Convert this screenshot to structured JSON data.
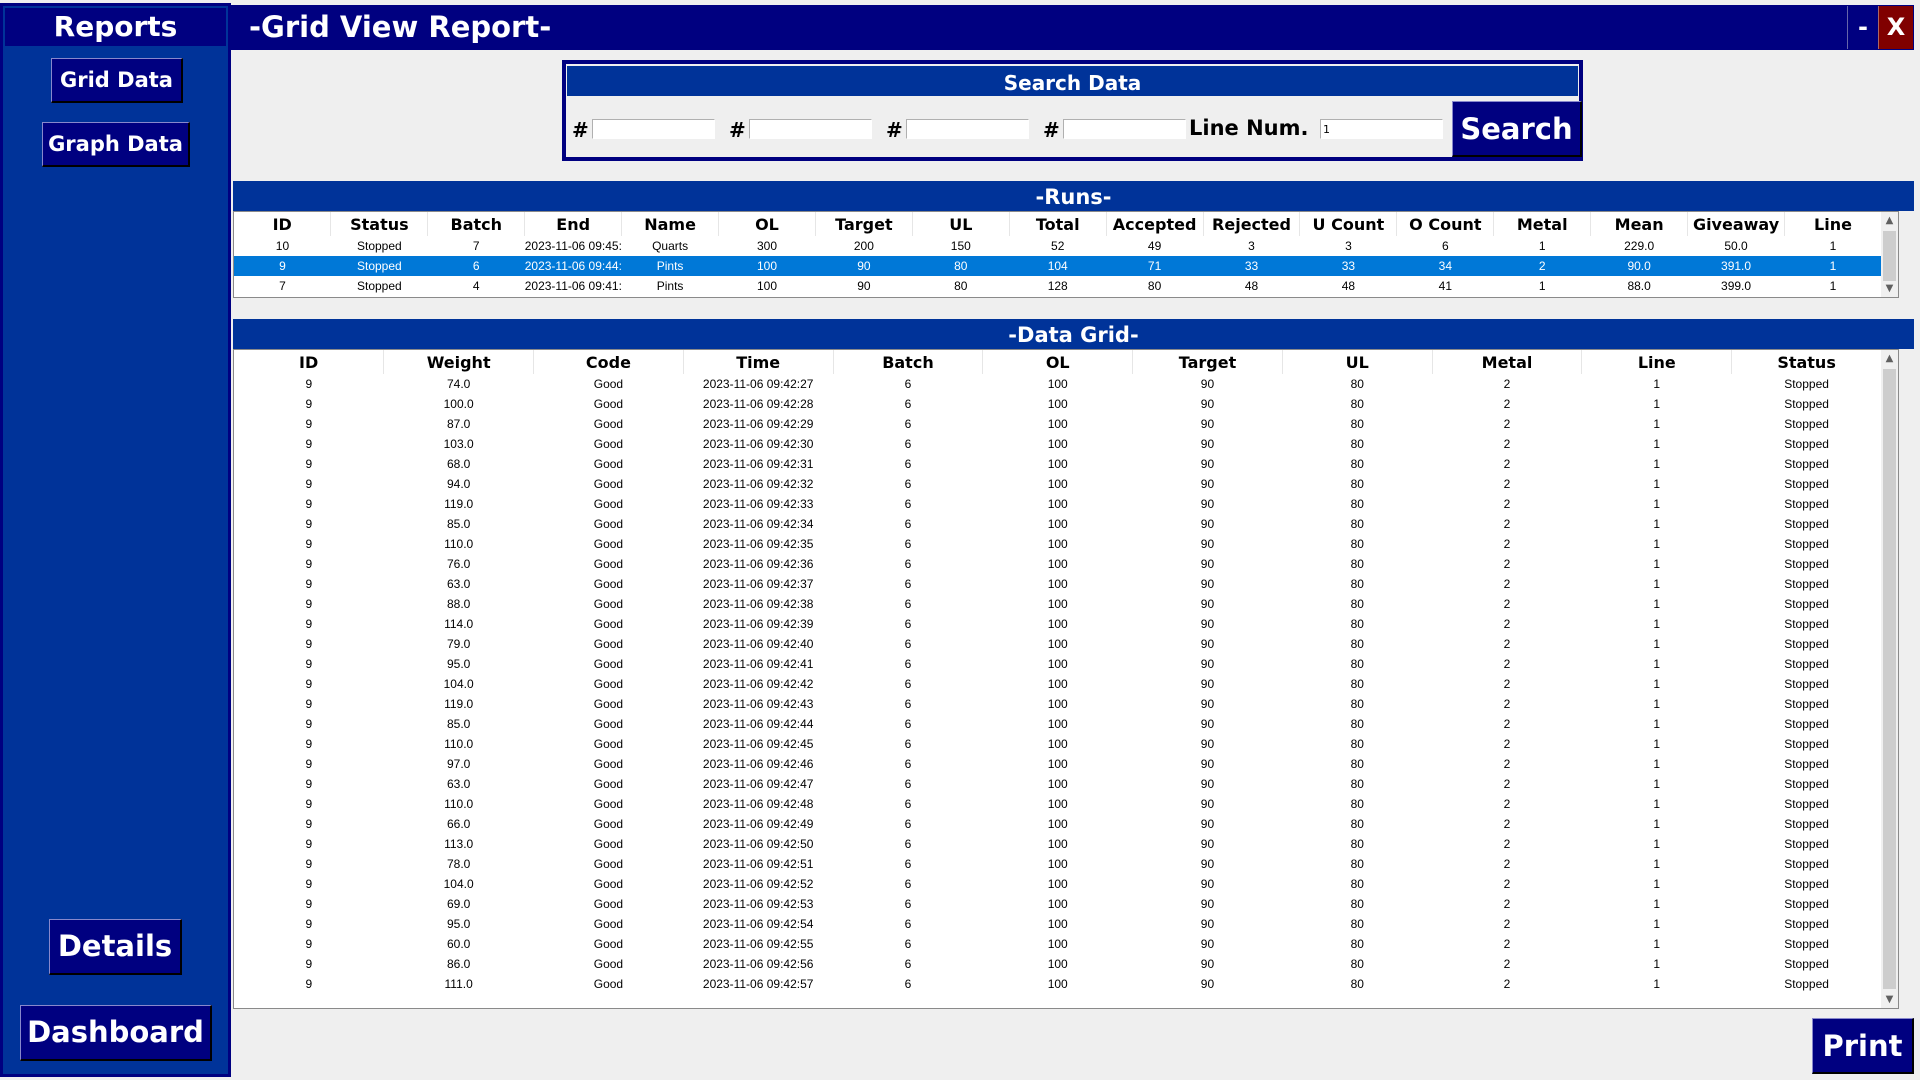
{
  "sidebar": {
    "title": "Reports",
    "grid_data_label": "Grid Data",
    "graph_data_label": "Graph Data",
    "details_label": "Details",
    "dashboard_label": "Dashboard"
  },
  "titlebar": {
    "title": "-Grid View Report-",
    "minimize_label": "-",
    "close_label": "X"
  },
  "search": {
    "title": "Search Data",
    "hash_label": "#",
    "fields": [
      "",
      "",
      "",
      ""
    ],
    "line_num_label": "Line Num.",
    "line_num_value": "1",
    "search_label": "Search"
  },
  "runs": {
    "title": "-Runs-",
    "columns": [
      "ID",
      "Status",
      "Batch",
      "End",
      "Name",
      "OL",
      "Target",
      "UL",
      "Total",
      "Accepted",
      "Rejected",
      "U Count",
      "O Count",
      "Metal",
      "Mean",
      "Giveaway",
      "Line"
    ],
    "selected_index": 1,
    "rows": [
      [
        "10",
        "Stopped",
        "7",
        "2023-11-06 09:45:",
        "Quarts",
        "300",
        "200",
        "150",
        "52",
        "49",
        "3",
        "3",
        "6",
        "1",
        "229.0",
        "50.0",
        "1"
      ],
      [
        "9",
        "Stopped",
        "6",
        "2023-11-06 09:44:",
        "Pints",
        "100",
        "90",
        "80",
        "104",
        "71",
        "33",
        "33",
        "34",
        "2",
        "90.0",
        "391.0",
        "1"
      ],
      [
        "7",
        "Stopped",
        "4",
        "2023-11-06 09:41:",
        "Pints",
        "100",
        "90",
        "80",
        "128",
        "80",
        "48",
        "48",
        "41",
        "1",
        "88.0",
        "399.0",
        "1"
      ]
    ]
  },
  "grid": {
    "title": "-Data Grid-",
    "columns": [
      "ID",
      "Weight",
      "Code",
      "Time",
      "Batch",
      "OL",
      "Target",
      "UL",
      "Metal",
      "Line",
      "Status"
    ],
    "rows": [
      [
        "9",
        "74.0",
        "Good",
        "2023-11-06 09:42:27",
        "6",
        "100",
        "90",
        "80",
        "2",
        "1",
        "Stopped"
      ],
      [
        "9",
        "100.0",
        "Good",
        "2023-11-06 09:42:28",
        "6",
        "100",
        "90",
        "80",
        "2",
        "1",
        "Stopped"
      ],
      [
        "9",
        "87.0",
        "Good",
        "2023-11-06 09:42:29",
        "6",
        "100",
        "90",
        "80",
        "2",
        "1",
        "Stopped"
      ],
      [
        "9",
        "103.0",
        "Good",
        "2023-11-06 09:42:30",
        "6",
        "100",
        "90",
        "80",
        "2",
        "1",
        "Stopped"
      ],
      [
        "9",
        "68.0",
        "Good",
        "2023-11-06 09:42:31",
        "6",
        "100",
        "90",
        "80",
        "2",
        "1",
        "Stopped"
      ],
      [
        "9",
        "94.0",
        "Good",
        "2023-11-06 09:42:32",
        "6",
        "100",
        "90",
        "80",
        "2",
        "1",
        "Stopped"
      ],
      [
        "9",
        "119.0",
        "Good",
        "2023-11-06 09:42:33",
        "6",
        "100",
        "90",
        "80",
        "2",
        "1",
        "Stopped"
      ],
      [
        "9",
        "85.0",
        "Good",
        "2023-11-06 09:42:34",
        "6",
        "100",
        "90",
        "80",
        "2",
        "1",
        "Stopped"
      ],
      [
        "9",
        "110.0",
        "Good",
        "2023-11-06 09:42:35",
        "6",
        "100",
        "90",
        "80",
        "2",
        "1",
        "Stopped"
      ],
      [
        "9",
        "76.0",
        "Good",
        "2023-11-06 09:42:36",
        "6",
        "100",
        "90",
        "80",
        "2",
        "1",
        "Stopped"
      ],
      [
        "9",
        "63.0",
        "Good",
        "2023-11-06 09:42:37",
        "6",
        "100",
        "90",
        "80",
        "2",
        "1",
        "Stopped"
      ],
      [
        "9",
        "88.0",
        "Good",
        "2023-11-06 09:42:38",
        "6",
        "100",
        "90",
        "80",
        "2",
        "1",
        "Stopped"
      ],
      [
        "9",
        "114.0",
        "Good",
        "2023-11-06 09:42:39",
        "6",
        "100",
        "90",
        "80",
        "2",
        "1",
        "Stopped"
      ],
      [
        "9",
        "79.0",
        "Good",
        "2023-11-06 09:42:40",
        "6",
        "100",
        "90",
        "80",
        "2",
        "1",
        "Stopped"
      ],
      [
        "9",
        "95.0",
        "Good",
        "2023-11-06 09:42:41",
        "6",
        "100",
        "90",
        "80",
        "2",
        "1",
        "Stopped"
      ],
      [
        "9",
        "104.0",
        "Good",
        "2023-11-06 09:42:42",
        "6",
        "100",
        "90",
        "80",
        "2",
        "1",
        "Stopped"
      ],
      [
        "9",
        "119.0",
        "Good",
        "2023-11-06 09:42:43",
        "6",
        "100",
        "90",
        "80",
        "2",
        "1",
        "Stopped"
      ],
      [
        "9",
        "85.0",
        "Good",
        "2023-11-06 09:42:44",
        "6",
        "100",
        "90",
        "80",
        "2",
        "1",
        "Stopped"
      ],
      [
        "9",
        "110.0",
        "Good",
        "2023-11-06 09:42:45",
        "6",
        "100",
        "90",
        "80",
        "2",
        "1",
        "Stopped"
      ],
      [
        "9",
        "97.0",
        "Good",
        "2023-11-06 09:42:46",
        "6",
        "100",
        "90",
        "80",
        "2",
        "1",
        "Stopped"
      ],
      [
        "9",
        "63.0",
        "Good",
        "2023-11-06 09:42:47",
        "6",
        "100",
        "90",
        "80",
        "2",
        "1",
        "Stopped"
      ],
      [
        "9",
        "110.0",
        "Good",
        "2023-11-06 09:42:48",
        "6",
        "100",
        "90",
        "80",
        "2",
        "1",
        "Stopped"
      ],
      [
        "9",
        "66.0",
        "Good",
        "2023-11-06 09:42:49",
        "6",
        "100",
        "90",
        "80",
        "2",
        "1",
        "Stopped"
      ],
      [
        "9",
        "113.0",
        "Good",
        "2023-11-06 09:42:50",
        "6",
        "100",
        "90",
        "80",
        "2",
        "1",
        "Stopped"
      ],
      [
        "9",
        "78.0",
        "Good",
        "2023-11-06 09:42:51",
        "6",
        "100",
        "90",
        "80",
        "2",
        "1",
        "Stopped"
      ],
      [
        "9",
        "104.0",
        "Good",
        "2023-11-06 09:42:52",
        "6",
        "100",
        "90",
        "80",
        "2",
        "1",
        "Stopped"
      ],
      [
        "9",
        "69.0",
        "Good",
        "2023-11-06 09:42:53",
        "6",
        "100",
        "90",
        "80",
        "2",
        "1",
        "Stopped"
      ],
      [
        "9",
        "95.0",
        "Good",
        "2023-11-06 09:42:54",
        "6",
        "100",
        "90",
        "80",
        "2",
        "1",
        "Stopped"
      ],
      [
        "9",
        "60.0",
        "Good",
        "2023-11-06 09:42:55",
        "6",
        "100",
        "90",
        "80",
        "2",
        "1",
        "Stopped"
      ],
      [
        "9",
        "86.0",
        "Good",
        "2023-11-06 09:42:56",
        "6",
        "100",
        "90",
        "80",
        "2",
        "1",
        "Stopped"
      ],
      [
        "9",
        "111.0",
        "Good",
        "2023-11-06 09:42:57",
        "6",
        "100",
        "90",
        "80",
        "2",
        "1",
        "Stopped"
      ]
    ]
  },
  "footer": {
    "print_label": "Print"
  },
  "icons": {
    "scroll_up": "▲",
    "scroll_down": "▼"
  },
  "colors": {
    "sidebar_bg": "#003399",
    "button_bg": "#000080",
    "close_bg": "#800000",
    "selected_row": "#0078d7"
  }
}
